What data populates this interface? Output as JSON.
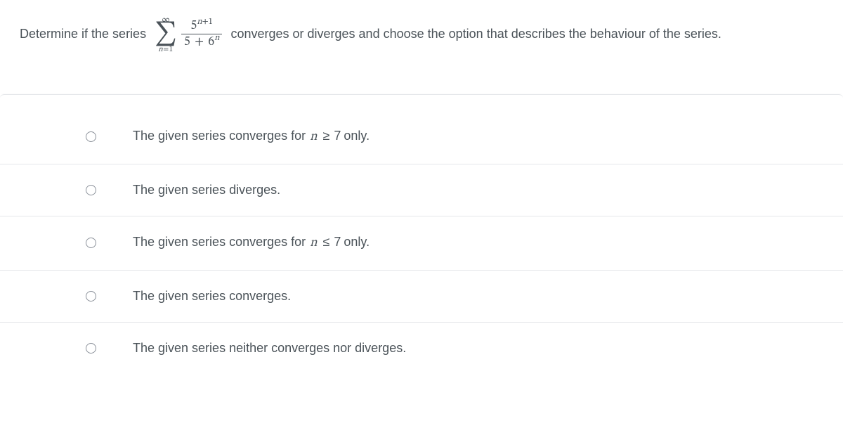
{
  "question": {
    "prefix": "Determine if the series",
    "sigma_top": "∞",
    "sigma_symbol": "∑",
    "sigma_bottom_var": "n",
    "sigma_bottom_eq": "=",
    "sigma_bottom_from": "1",
    "numerator_base": "5",
    "numerator_exp_var": "n",
    "numerator_exp_plus": "+1",
    "denominator_left": "5",
    "denominator_plus": "+",
    "denominator_right_base": "6",
    "denominator_right_exp": "n",
    "suffix": "converges or diverges and choose the option that describes the behaviour of the series."
  },
  "options": [
    {
      "pre": "The given series converges for ",
      "math_var": "n",
      "math_rel": "≥",
      "math_val": "7",
      "post": " only."
    },
    {
      "pre": "The given series diverges.",
      "math_var": "",
      "math_rel": "",
      "math_val": "",
      "post": ""
    },
    {
      "pre": "The given series converges for ",
      "math_var": "n",
      "math_rel": "≤",
      "math_val": "7",
      "post": " only."
    },
    {
      "pre": "The given series converges.",
      "math_var": "",
      "math_rel": "",
      "math_val": "",
      "post": ""
    },
    {
      "pre": "The given series neither converges nor diverges.",
      "math_var": "",
      "math_rel": "",
      "math_val": "",
      "post": ""
    }
  ]
}
